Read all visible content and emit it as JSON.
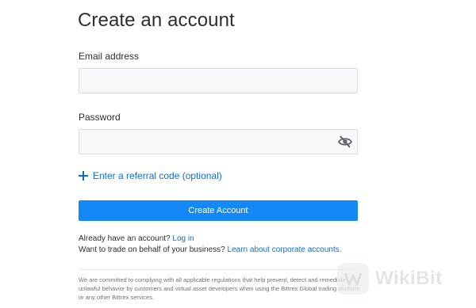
{
  "form": {
    "title": "Create an account",
    "email_label": "Email address",
    "email_value": "",
    "password_label": "Password",
    "password_value": "",
    "referral_link": "Enter a referral code (optional)",
    "submit_label": "Create Account"
  },
  "footer": {
    "login_prompt": "Already have an account?",
    "login_link": "Log in",
    "business_prompt": "Want to trade on behalf of your business?",
    "business_link": "Learn about corporate accounts.",
    "disclaimer": "We are committed to complying with all applicable regulations that help prevent, detect and remediate unlawful behavior by customers and virtual asset developers when using the Bittrex Global trading platform or any other Bittrex services."
  },
  "watermark": {
    "text": "WikiBit"
  },
  "icons": {
    "password_toggle": "eye-slash-icon",
    "referral": "plus-icon"
  },
  "colors": {
    "primary": "#1489f5",
    "link": "#0a6fd6",
    "input_bg": "#f7f8f9"
  }
}
